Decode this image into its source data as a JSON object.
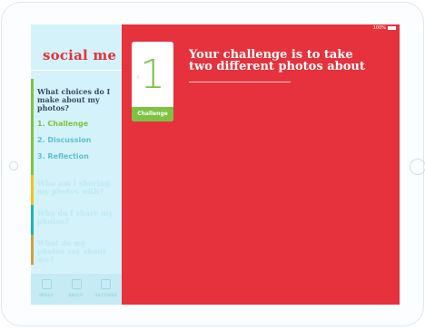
{
  "status": {
    "battery_text": "100%"
  },
  "app": {
    "logo": "social me"
  },
  "sidebar": {
    "active_question": "What choices do I make about my photos?",
    "steps": [
      {
        "number": "1.",
        "label": "Challenge"
      },
      {
        "number": "2.",
        "label": "Discussion"
      },
      {
        "number": "3.",
        "label": "Reflection"
      }
    ],
    "questions": [
      {
        "text": "Who am I sharing my photos with?"
      },
      {
        "text": "Why do I share my photos?"
      },
      {
        "text": "What do my photos say about me?"
      }
    ]
  },
  "toolbar": {
    "items": [
      {
        "label": "INDEX",
        "icon": "index-icon"
      },
      {
        "label": "ABOUT",
        "icon": "about-icon"
      },
      {
        "label": "SETTINGS",
        "icon": "settings-icon"
      }
    ]
  },
  "card": {
    "number": "1",
    "tag": "Challenge",
    "chevron": "‹"
  },
  "main": {
    "challenge_text": "Your challenge is to take two different photos about"
  },
  "colors": {
    "main_bg": "#e5323c",
    "sidebar_bg": "#d4f2f9",
    "accent_green": "#7dc242",
    "step_blue": "#5cc0d6"
  }
}
